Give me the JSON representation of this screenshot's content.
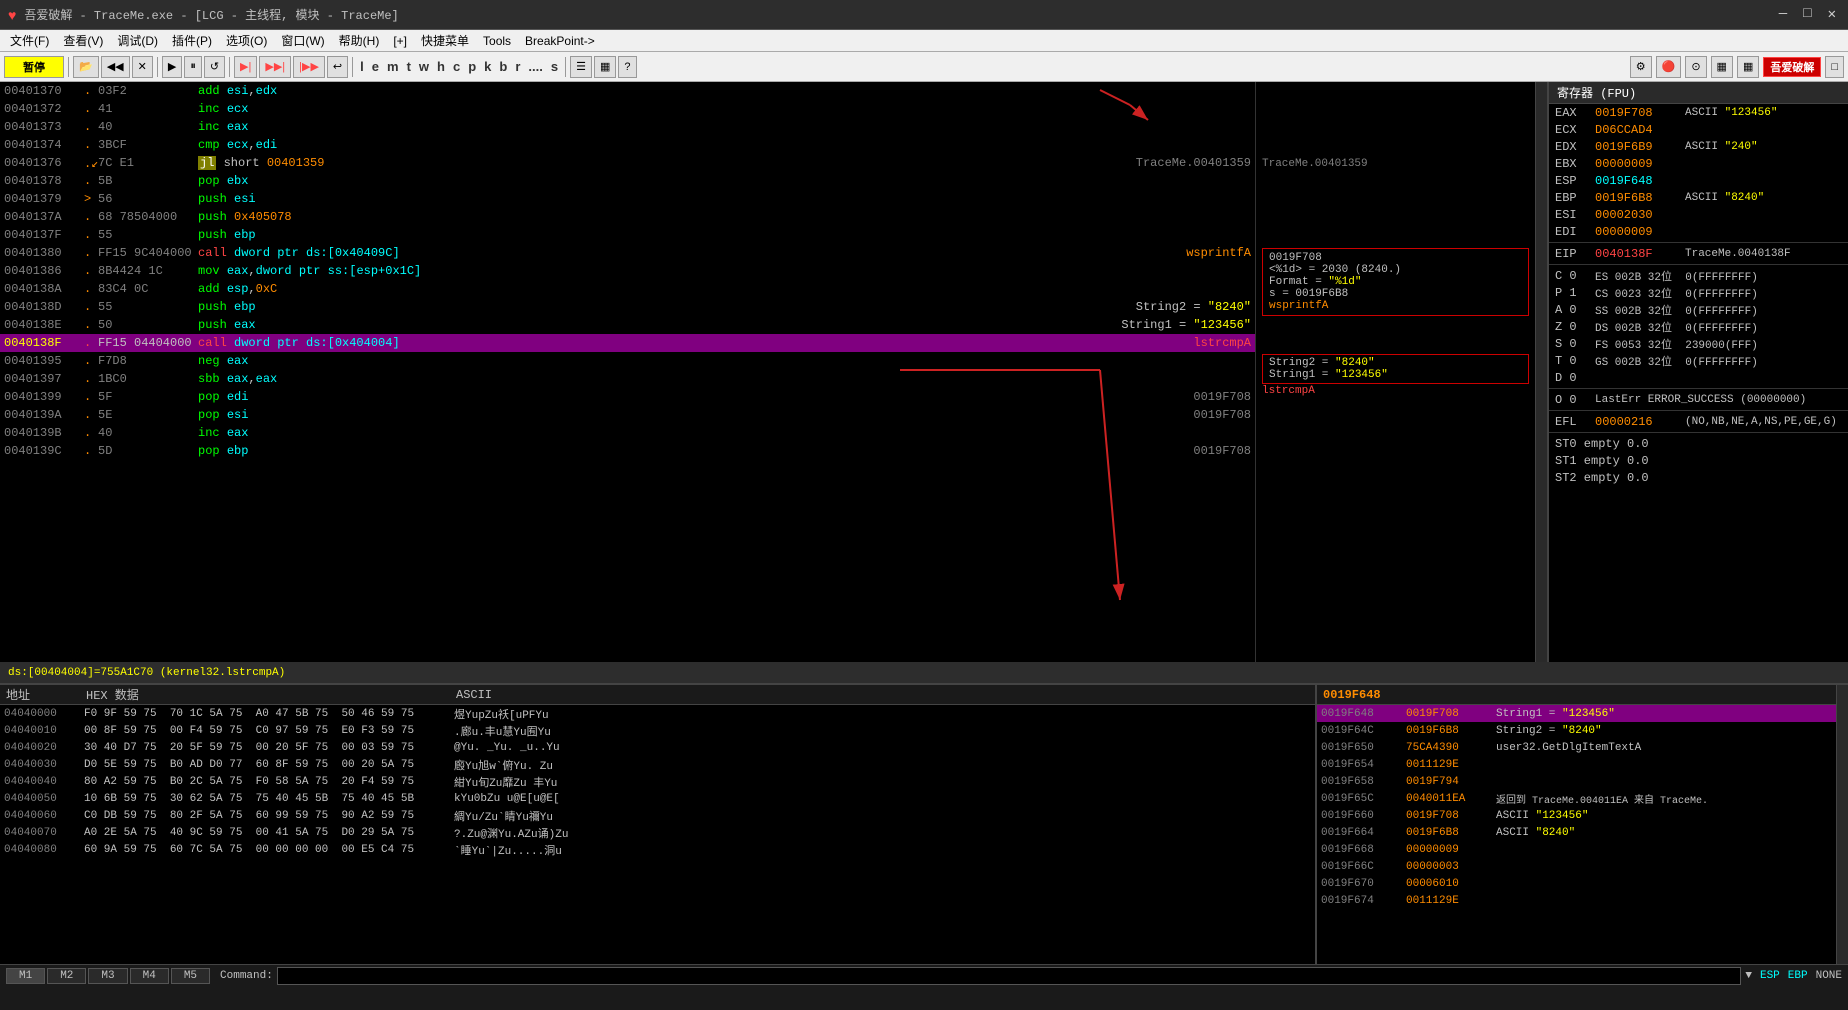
{
  "window": {
    "title": "吾爱破解 - TraceMe.exe - [LCG - 主线程, 模块 - TraceMe]",
    "controls": [
      "—",
      "□",
      "✕"
    ]
  },
  "menu": {
    "items": [
      {
        "id": "file",
        "label": "文件(F)"
      },
      {
        "id": "view",
        "label": "查看(V)"
      },
      {
        "id": "debug",
        "label": "调试(D)"
      },
      {
        "id": "plugins",
        "label": "插件(P)"
      },
      {
        "id": "options",
        "label": "选项(O)"
      },
      {
        "id": "window",
        "label": "窗口(W)"
      },
      {
        "id": "help",
        "label": "帮助(H)"
      },
      {
        "id": "plus",
        "label": "[+]"
      },
      {
        "id": "shortcuts",
        "label": "快捷菜单"
      },
      {
        "id": "tools",
        "label": "Tools"
      },
      {
        "id": "breakpoint",
        "label": "BreakPoint->"
      }
    ]
  },
  "toolbar": {
    "pause_label": "暂停",
    "letters": [
      "l",
      "e",
      "m",
      "t",
      "w",
      "h",
      "c",
      "p",
      "k",
      "b",
      "r",
      "....",
      "s"
    ]
  },
  "status_bar": {
    "text": "ds:[00404004]=755A1C70 (kernel32.lstrcmpA)"
  },
  "disasm": {
    "rows": [
      {
        "addr": "00401370",
        "marker": " ",
        "hex": "03F2",
        "instr": "add esi,edx",
        "comment": ""
      },
      {
        "addr": "00401372",
        "marker": " ",
        "hex": "41",
        "instr": "inc ecx",
        "comment": ""
      },
      {
        "addr": "00401373",
        "marker": " ",
        "hex": "40",
        "instr": "inc eax",
        "comment": ""
      },
      {
        "addr": "00401374",
        "marker": " ",
        "hex": "3BCF",
        "instr": "cmp ecx,edi",
        "comment": ""
      },
      {
        "addr": "00401376",
        "marker": "↙",
        "hex": "7C E1",
        "instr": "jl short 00401359",
        "comment": "TraceMe.00401359"
      },
      {
        "addr": "00401378",
        "marker": " ",
        "hex": "5B",
        "instr": "pop ebx",
        "comment": ""
      },
      {
        "addr": "00401379",
        "marker": " ",
        "hex": "56",
        "instr": "push esi",
        "comment": ""
      },
      {
        "addr": "0040137A",
        "marker": " ",
        "hex": "68 78504000",
        "instr": "push 0x405078",
        "comment": ""
      },
      {
        "addr": "0040137F",
        "marker": " ",
        "hex": "55",
        "instr": "push ebp",
        "comment": ""
      },
      {
        "addr": "00401380",
        "marker": " ",
        "hex": "FF15 9C404000",
        "instr": "call dword ptr ds:[0x40409C]",
        "comment": "wsprintfA"
      },
      {
        "addr": "00401386",
        "marker": " ",
        "hex": "8B4424 1C",
        "instr": "mov eax,dword ptr ss:[esp+0x1C]",
        "comment": ""
      },
      {
        "addr": "0040138A",
        "marker": " ",
        "hex": "83C4 0C",
        "instr": "add esp,0xC",
        "comment": ""
      },
      {
        "addr": "0040138D",
        "marker": " ",
        "hex": "55",
        "instr": "push ebp",
        "comment": "String2 = \"8240\""
      },
      {
        "addr": "0040138E",
        "marker": " ",
        "hex": "50",
        "instr": "push eax",
        "comment": "String1 = \"123456\""
      },
      {
        "addr": "0040138F",
        "marker": "►",
        "hex": "FF15 04404000",
        "instr": "call dword ptr ds:[0x404004]",
        "comment": "lstrcmpA",
        "highlighted": true
      },
      {
        "addr": "00401395",
        "marker": " ",
        "hex": "F7D8",
        "instr": "neg eax",
        "comment": ""
      },
      {
        "addr": "00401397",
        "marker": " ",
        "hex": "1BC0",
        "instr": "sbb eax,eax",
        "comment": ""
      },
      {
        "addr": "00401399",
        "marker": " ",
        "hex": "5F",
        "instr": "pop edi",
        "comment": "0019F708"
      },
      {
        "addr": "0040139A",
        "marker": " ",
        "hex": "5E",
        "instr": "pop esi",
        "comment": "0019F708"
      },
      {
        "addr": "0040139B",
        "marker": " ",
        "hex": "40",
        "instr": "inc eax",
        "comment": ""
      },
      {
        "addr": "0040139C",
        "marker": " ",
        "hex": "5D",
        "instr": "pop ebp",
        "comment": "0019F708"
      }
    ]
  },
  "disasm_annotations": {
    "jl_comment": "TraceMe.00401359",
    "call1_comment": "0019F708\n<%1d> = 2030 (8240.)\nFormat = \"%1d\"\ns = 0019F6B8\nwsprintfA",
    "push_ebp_comment": "String2 = \"8240\"",
    "push_eax_comment": "String1 = \"123456\"",
    "call2_comment": "lstrcmpA"
  },
  "registers": {
    "title": "寄存器 (FPU)",
    "rows": [
      {
        "name": "EAX",
        "val": "0019F708",
        "annot": "ASCII \"123456\"",
        "color": "normal"
      },
      {
        "name": "ECX",
        "val": "D06CCAD4",
        "annot": "",
        "color": "normal"
      },
      {
        "name": "EDX",
        "val": "0019F6B9",
        "annot": "ASCII \"240\"",
        "color": "normal"
      },
      {
        "name": "EBX",
        "val": "00000009",
        "annot": "",
        "color": "normal"
      },
      {
        "name": "ESP",
        "val": "0019F648",
        "annot": "",
        "color": "cyan"
      },
      {
        "name": "EBP",
        "val": "0019F6B8",
        "annot": "ASCII \"8240\"",
        "color": "normal"
      },
      {
        "name": "ESI",
        "val": "00002030",
        "annot": "",
        "color": "normal"
      },
      {
        "name": "EDI",
        "val": "00000009",
        "annot": "",
        "color": "normal"
      },
      {
        "name": "",
        "val": "",
        "annot": "",
        "color": "sep"
      },
      {
        "name": "EIP",
        "val": "0040138F",
        "annot": "TraceMe.0040138F",
        "color": "red"
      },
      {
        "name": "",
        "val": "",
        "annot": "",
        "color": "sep"
      },
      {
        "name": "C 0",
        "val": "",
        "annot": "ES 002B 32位 0(FFFFFFFF)",
        "color": "flag"
      },
      {
        "name": "P 1",
        "val": "",
        "annot": "CS 0023 32位 0(FFFFFFFF)",
        "color": "flag"
      },
      {
        "name": "A 0",
        "val": "",
        "annot": "SS 002B 32位 0(FFFFFFFF)",
        "color": "flag"
      },
      {
        "name": "Z 0",
        "val": "",
        "annot": "DS 002B 32位 0(FFFFFFFF)",
        "color": "flag"
      },
      {
        "name": "S 0",
        "val": "",
        "annot": "FS 0053 32位 239000(FFF)",
        "color": "flag"
      },
      {
        "name": "T 0",
        "val": "",
        "annot": "GS 002B 32位 0(FFFFFFFF)",
        "color": "flag"
      },
      {
        "name": "D 0",
        "val": "",
        "annot": "",
        "color": "flag"
      },
      {
        "name": "",
        "val": "",
        "annot": "",
        "color": "sep"
      },
      {
        "name": "O 0",
        "val": "",
        "annot": "LastErr ERROR_SUCCESS (00000000)",
        "color": "flag"
      },
      {
        "name": "",
        "val": "",
        "annot": "",
        "color": "sep"
      },
      {
        "name": "EFL",
        "val": "00000216",
        "annot": "(NO,NB,NE,A,NS,PE,GE,G)",
        "color": "flag2"
      }
    ],
    "fpu": [
      {
        "name": "ST0",
        "val": "empty 0.0"
      },
      {
        "name": "ST1",
        "val": "empty 0.0"
      },
      {
        "name": "ST2",
        "val": "empty 0.0"
      }
    ]
  },
  "hex_dump": {
    "header": {
      "addr_col": "地址",
      "hex_col": "HEX 数据",
      "ascii_col": "ASCII"
    },
    "rows": [
      {
        "addr": "04040000",
        "bytes": "F0 9F 59 75  70 1C 5A 75  A0 47 5B 75  50 46 59 75",
        "ascii": "煜YupZu祅[uPFYu"
      },
      {
        "addr": "04040010",
        "bytes": "00 8F 59 75  00 F4 59 75  C0 97 59 75  E0 F3 59 75",
        "ascii": ".廊u.丰u慧Yu囿Yu"
      },
      {
        "addr": "04040020",
        "bytes": "30 40 D7 75  20 5F 59 75  00 20 5F 75  00 03 59 75",
        "ascii": "0@Yu _Yu. _u..Yu"
      },
      {
        "addr": "04040030",
        "bytes": "D0 5E 59 75  B0 AD D0 77  60 8F 59 75  00 20 5A 75",
        "ascii": "廏Yu旭Dw`俯Yu. Zu"
      },
      {
        "addr": "04040040",
        "bytes": "80 A2 59 75  B0 2C 5A 75  F0 58 5A 75  20 F4 59 75",
        "ascii": "紺Yu旬Zu靡Zu 丰Yu"
      },
      {
        "addr": "04040050",
        "bytes": "10 6B 59 75  30 62 5A 75  75 40 45 5B  75 40 45 5B",
        "ascii": "kYu0bZuu@E[u@E["
      },
      {
        "addr": "04040060",
        "bytes": "C0 DB 59 75  80 2F 5A 75  60 99 59 75  90 A2 59 75",
        "ascii": "綢Yu€/Zu`睛Yu禰Yu"
      },
      {
        "addr": "04040070",
        "bytes": "A0 2E 5A 75  40 9C 59 75  00 41 5A 75  D0 29 5A 75",
        "ascii": "?.Zu@渊Yu.AZu诵)Zu"
      },
      {
        "addr": "04040080",
        "bytes": "60 9A 59 75  60 7C 5A 75  00 00 00 00  00 E5 C4 75",
        "ascii": "`睡Yu`|Zu.....洞u"
      }
    ]
  },
  "stack": {
    "header_addr": "0019F648",
    "rows": [
      {
        "addr": "0019F648",
        "val": "0019F708",
        "annot": "String1 = \"123456\"",
        "highlighted": true
      },
      {
        "addr": "0019F64C",
        "val": "0019F6B8",
        "annot": "String2 = \"8240\""
      },
      {
        "addr": "0019F650",
        "val": "75CA4390",
        "annot": "user32.GetDlgItemTextA"
      },
      {
        "addr": "0019F654",
        "val": "0011129E",
        "annot": ""
      },
      {
        "addr": "0019F658",
        "val": "0019F794",
        "annot": ""
      },
      {
        "addr": "0019F65C",
        "val": "0040011EA",
        "annot": "返回到 TraceMe.004011EA 来自 TraceMe.."
      },
      {
        "addr": "0019F660",
        "val": "0019F708",
        "annot": "ASCII \"123456\""
      },
      {
        "addr": "0019F664",
        "val": "0019F6B8",
        "annot": "ASCII \"8240\""
      },
      {
        "addr": "0019F668",
        "val": "00000009",
        "annot": ""
      },
      {
        "addr": "0019F66C",
        "val": "00000003",
        "annot": ""
      },
      {
        "addr": "0019F670",
        "val": "00006010",
        "annot": ""
      },
      {
        "addr": "0019F674",
        "val": "0011129E",
        "annot": ""
      }
    ]
  },
  "bottom_status": {
    "tabs": [
      "M1",
      "M2",
      "M3",
      "M4",
      "M5"
    ],
    "command_label": "Command:",
    "esp_label": "ESP",
    "ebp_label": "EBP",
    "none_label": "NONE"
  }
}
